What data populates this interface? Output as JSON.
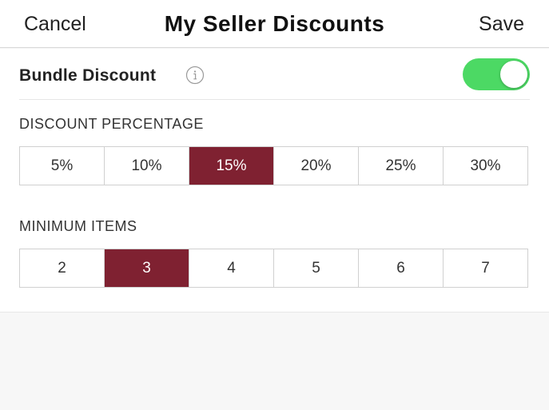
{
  "colors": {
    "accent": "#7f2131",
    "toggle_on": "#4cd964"
  },
  "nav": {
    "cancel_label": "Cancel",
    "title": "My Seller Discounts",
    "save_label": "Save"
  },
  "bundle": {
    "label": "Bundle Discount",
    "info_icon": "info-icon",
    "enabled": true
  },
  "discount": {
    "header": "DISCOUNT PERCENTAGE",
    "options": [
      "5%",
      "10%",
      "15%",
      "20%",
      "25%",
      "30%"
    ],
    "selected": "15%"
  },
  "minimum_items": {
    "header": "MINIMUM ITEMS",
    "options": [
      "2",
      "3",
      "4",
      "5",
      "6",
      "7"
    ],
    "selected": "3"
  }
}
